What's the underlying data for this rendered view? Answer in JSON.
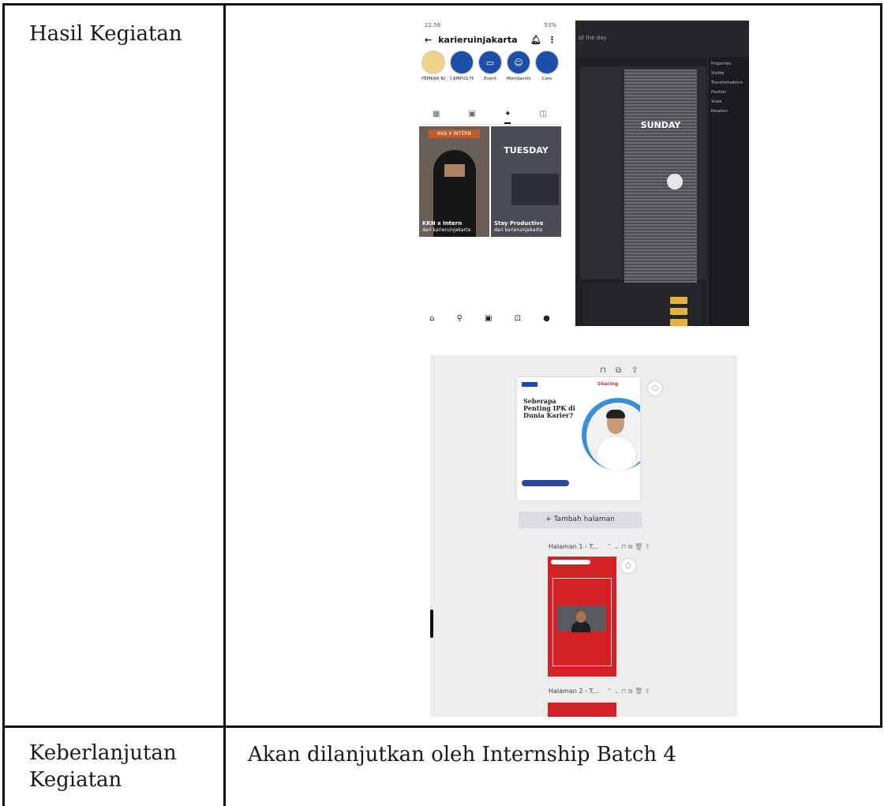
{
  "table": {
    "rows": [
      {
        "label": "Hasil Kegiatan"
      },
      {
        "label_line1": "Keberlanjutan",
        "label_line2": "Kegiatan",
        "value": "Akan dilanjutkan oleh Internship Batch 4"
      }
    ]
  },
  "phone": {
    "status_time": "22.56",
    "status_right": "53%",
    "profile_name": "karieruinjakarta",
    "highlights": [
      {
        "label": "PEMKAR BA...",
        "color": "#e9a83a"
      },
      {
        "label": "CAMPUS HI...",
        "color": "#1d4fa8"
      },
      {
        "label": "Event",
        "color": "#1d4fa8"
      },
      {
        "label": "Membership",
        "color": "#1d4fa8"
      },
      {
        "label": "Care",
        "color": "#1d4fa8"
      }
    ],
    "reels": [
      {
        "banner": "KKN X INTERN",
        "title": "KKN x Intern",
        "subtitle": "dari karieruinjakarta"
      },
      {
        "banner": "TUESDAY",
        "title": "Stay Productive",
        "subtitle": "dari karieruinjakarta"
      }
    ]
  },
  "editor": {
    "tab_text": "of the day",
    "story_text": "SUNDAY",
    "side_items": [
      "Properties",
      "Visible",
      "Transformations",
      "Position",
      "Scale",
      "Rotation"
    ]
  },
  "canva": {
    "poster": {
      "title": "Seberapa Penting IPK di Dunia Karier?",
      "brand": "Sharing"
    },
    "add_page": "+ Tambah halaman",
    "page1": "Halaman 1 - T...",
    "page2": "Halaman 2 - T..."
  }
}
